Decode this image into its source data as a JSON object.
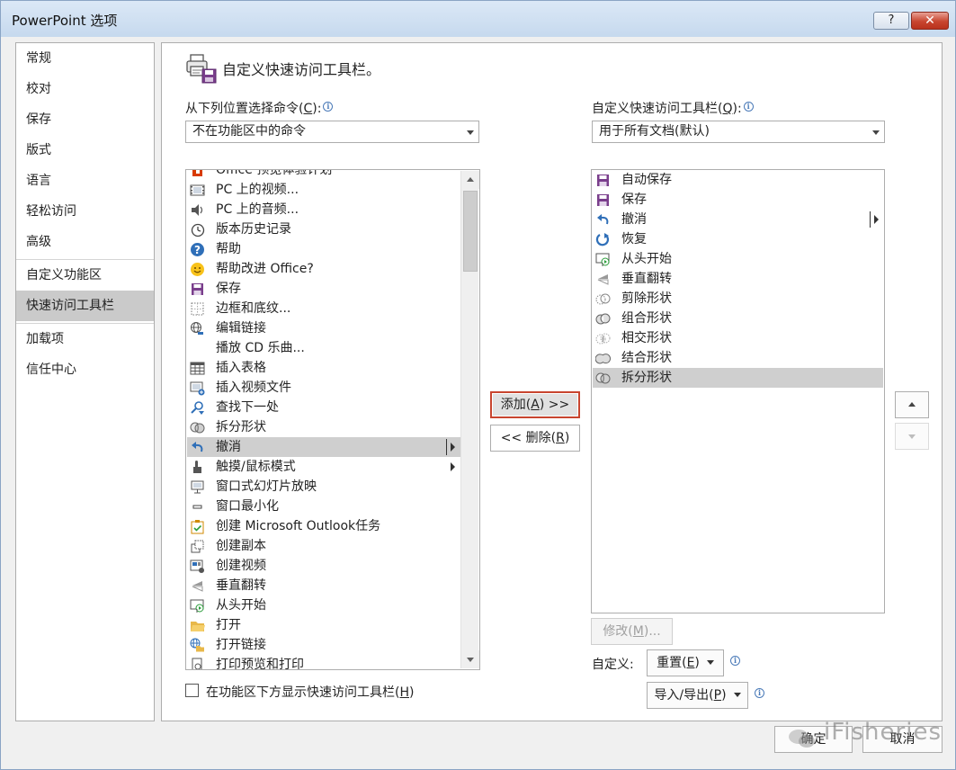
{
  "window": {
    "title": "PowerPoint 选项",
    "help_label": "?",
    "close_label": "✕"
  },
  "sidebar": {
    "items": [
      "常规",
      "校对",
      "保存",
      "版式",
      "语言",
      "轻松访问",
      "高级",
      "自定义功能区",
      "快速访问工具栏",
      "加载项",
      "信任中心"
    ],
    "active": "快速访问工具栏"
  },
  "header": {
    "title": "自定义快速访问工具栏。",
    "icon": "quick-access-toolbar-icon"
  },
  "left": {
    "label_text": "从下列位置选择命令(",
    "label_key": "C",
    "label_end": "):",
    "dropdown_value": "不在功能区中的命令",
    "commands": [
      {
        "icon": "office-insider-icon",
        "label": "Office 预览体验计划"
      },
      {
        "icon": "film-icon",
        "label": "PC 上的视频..."
      },
      {
        "icon": "speaker-icon",
        "label": "PC 上的音频..."
      },
      {
        "icon": "history-icon",
        "label": "版本历史记录"
      },
      {
        "icon": "help-icon",
        "label": "帮助"
      },
      {
        "icon": "smiley-icon",
        "label": "帮助改进 Office?"
      },
      {
        "icon": "save-icon",
        "label": "保存"
      },
      {
        "icon": "borders-icon",
        "label": "边框和底纹..."
      },
      {
        "icon": "edit-links-icon",
        "label": "编辑链接"
      },
      {
        "icon": "",
        "label": "播放 CD 乐曲..."
      },
      {
        "icon": "table-icon",
        "label": "插入表格"
      },
      {
        "icon": "insert-video-icon",
        "label": "插入视频文件"
      },
      {
        "icon": "find-next-icon",
        "label": "查找下一处"
      },
      {
        "icon": "split-shapes-icon",
        "label": "拆分形状"
      },
      {
        "icon": "undo-icon",
        "label": "撤消"
      },
      {
        "icon": "touch-icon",
        "label": "触摸/鼠标模式"
      },
      {
        "icon": "windowed-slideshow-icon",
        "label": "窗口式幻灯片放映"
      },
      {
        "icon": "minimize-icon",
        "label": "窗口最小化"
      },
      {
        "icon": "outlook-task-icon",
        "label": "创建 Microsoft Outlook任务"
      },
      {
        "icon": "duplicate-icon",
        "label": "创建副本"
      },
      {
        "icon": "create-video-icon",
        "label": "创建视频"
      },
      {
        "icon": "flip-vertical-icon",
        "label": "垂直翻转"
      },
      {
        "icon": "from-beginning-icon",
        "label": "从头开始"
      },
      {
        "icon": "folder-open-icon",
        "label": "打开"
      },
      {
        "icon": "open-link-icon",
        "label": "打开链接"
      },
      {
        "icon": "print-preview-icon",
        "label": "打印预览和打印"
      }
    ],
    "selected": "撤消",
    "show_below_label": "在功能区下方显示快速访问工具栏(",
    "show_below_key": "H",
    "show_below_end": ")"
  },
  "right": {
    "label_text": "自定义快速访问工具栏(",
    "label_key": "Q",
    "label_end": "):",
    "dropdown_value": "用于所有文档(默认)",
    "items": [
      {
        "icon": "autosave-icon",
        "label": "自动保存"
      },
      {
        "icon": "save-icon",
        "label": "保存"
      },
      {
        "icon": "undo-icon",
        "label": "撤消"
      },
      {
        "icon": "redo-icon",
        "label": "恢复"
      },
      {
        "icon": "from-beginning-icon",
        "label": "从头开始"
      },
      {
        "icon": "flip-vertical-icon",
        "label": "垂直翻转"
      },
      {
        "icon": "subtract-shapes-icon",
        "label": "剪除形状"
      },
      {
        "icon": "combine-shapes-icon",
        "label": "组合形状"
      },
      {
        "icon": "intersect-shapes-icon",
        "label": "相交形状"
      },
      {
        "icon": "union-shapes-icon",
        "label": "结合形状"
      },
      {
        "icon": "split-shapes-icon",
        "label": "拆分形状"
      }
    ],
    "selected": "拆分形状",
    "modify_label": "修改(",
    "modify_key": "M",
    "modify_end": ")...",
    "customize_label": "自定义:",
    "reset_label": "重置(",
    "reset_key": "E",
    "reset_end": ")",
    "import_export_label": "导入/导出(",
    "import_export_key": "P",
    "import_export_end": ")"
  },
  "middle": {
    "add_label": "添加(",
    "add_key": "A",
    "add_end": ") >>",
    "remove_label": "<< 删除(",
    "remove_key": "R",
    "remove_end": ")"
  },
  "footer": {
    "ok_label": "确定",
    "cancel_label": "取消"
  },
  "watermark": "iFisheries",
  "colors": {
    "accent_red": "#c8452f",
    "selection": "#cfcfcf",
    "title_gradient": "#c6d9ee"
  }
}
